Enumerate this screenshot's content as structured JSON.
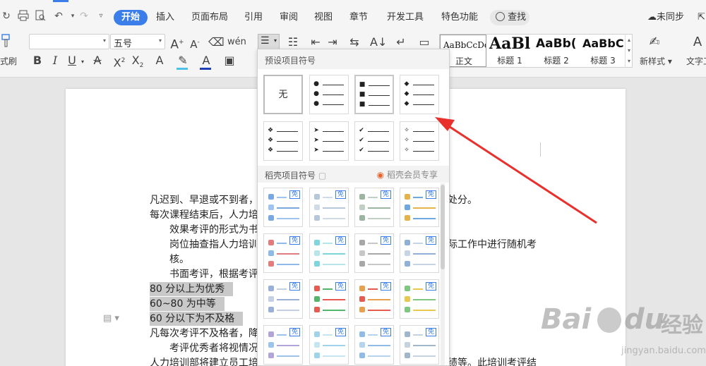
{
  "menubar": {
    "tabs": [
      {
        "label": "开始",
        "active": true
      },
      {
        "label": "插入"
      },
      {
        "label": "页面布局"
      },
      {
        "label": "引用"
      },
      {
        "label": "审阅"
      },
      {
        "label": "视图"
      },
      {
        "label": "章节"
      },
      {
        "label": "开发工具"
      },
      {
        "label": "特色功能"
      }
    ],
    "search_label": "查找",
    "sync_label": "未同步",
    "share_label": "分"
  },
  "toolbar": {
    "format_painter_label": "式刷",
    "font_size": "五号",
    "new_style_label": "新样式",
    "text_tool_label": "文字工",
    "styles": [
      {
        "sample": "AaBbCcDd",
        "name": "正文"
      },
      {
        "sample": "AaBl",
        "name": "标题 1"
      },
      {
        "sample": "AaBb(",
        "name": "标题 2"
      },
      {
        "sample": "AaBbC",
        "name": "标题 3"
      }
    ],
    "colors": {
      "highlight": "#4fc0e8",
      "font": "#1f3fb8",
      "accent": "#3b7ee9"
    }
  },
  "bullet_panel": {
    "preset_title": "预设项目符号",
    "none_label": "无",
    "daoke_title": "稻壳项目符号",
    "vip_label": "稻壳会员专享",
    "free_tag": "免"
  },
  "document": {
    "lines": [
      {
        "text": "凡迟到、早退或不到者，",
        "style": "plain"
      },
      {
        "text": "每次课程结束后，人力培",
        "style": "plain"
      },
      {
        "text": "效果考评的形式为书",
        "style": "indent"
      },
      {
        "text": "岗位抽查指人力培训",
        "style": "indent"
      },
      {
        "text": "核。",
        "style": "indent"
      },
      {
        "text": "书面考评，根据考评",
        "style": "indent"
      },
      {
        "text": "80 分以上为优秀",
        "style": "highlight"
      },
      {
        "text": "60~80 为中等",
        "style": "highlight"
      },
      {
        "text": "60 分以下为不及格",
        "style": "highlight"
      },
      {
        "text": "凡每次考评不及格者，降",
        "style": "plain"
      },
      {
        "text": "考评优秀者将视情况",
        "style": "indent"
      },
      {
        "text": "人力培训部将建立员工培",
        "style": "plain"
      }
    ],
    "right_fragments": [
      "处分。",
      "际工作中进行随机考",
      "绩等。此培训考评结"
    ]
  }
}
